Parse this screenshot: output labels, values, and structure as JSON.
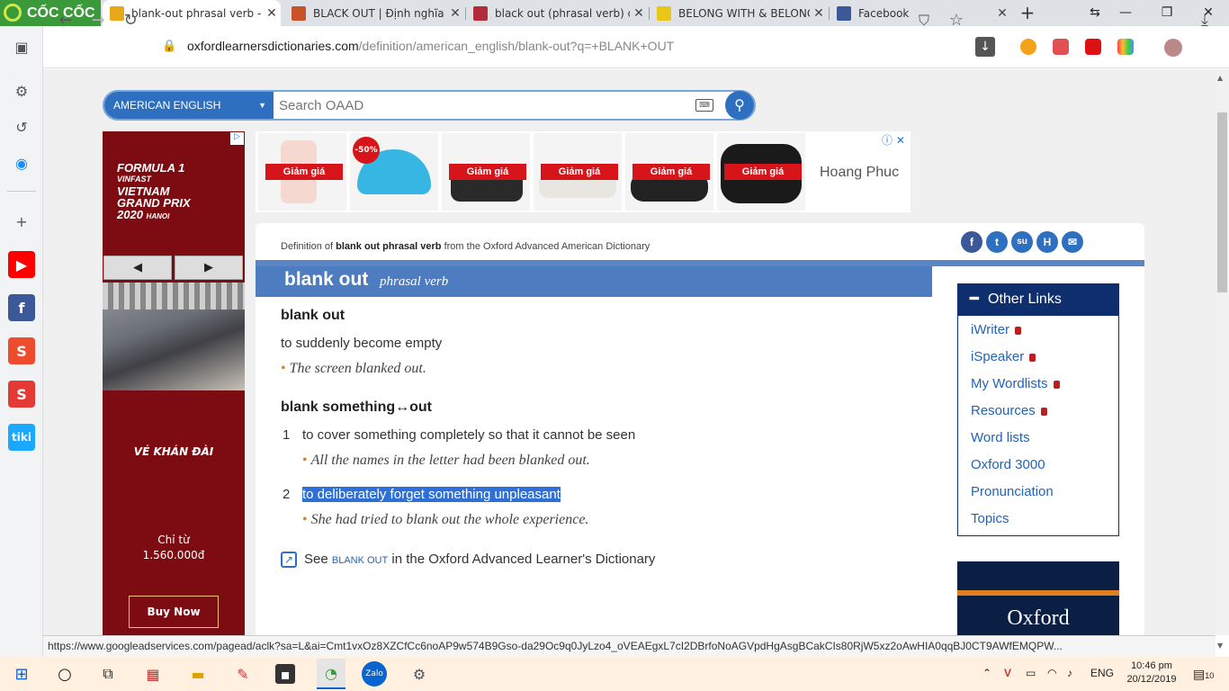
{
  "browser": {
    "brand": "CỐC CỐC"
  },
  "tabs": [
    {
      "title": "blank-out phrasal verb - De",
      "fav_color": "#e7a81b"
    },
    {
      "title": "BLACK OUT | Định nghĩa tro",
      "fav_color": "#c9522b"
    },
    {
      "title": "black out (phrasal verb) def",
      "fav_color": "#b22b3a"
    },
    {
      "title": "BELONG WITH & BELONG T",
      "fav_color": "#e9c71a"
    },
    {
      "title": "Facebook",
      "fav_color": "#3b5998"
    }
  ],
  "address": {
    "domain": "oxfordlearnersdictionaries.com",
    "path": "/definition/american_english/blank-out?q=+BLANK+OUT"
  },
  "search": {
    "dictionary": "AMERICAN ENGLISH",
    "placeholder": "Search OAAD"
  },
  "ads": {
    "left": {
      "nav_prev": "◀",
      "nav_next": "▶",
      "logo_lines": [
        "FORMULA 1",
        "VINFAST",
        "VIETNAM",
        "GRAND PRIX",
        "2020"
      ],
      "logo_city": "HANOI",
      "tagline": "VÉ KHÁN ĐÀI",
      "price_prefix": "Chỉ từ",
      "price": "1.560.000đ",
      "cta": "Buy Now"
    },
    "top": {
      "sale_label": "Giảm giá",
      "discount_badge": "-50%",
      "brand": "Hoang Phuc"
    }
  },
  "entry": {
    "source_prefix": "Definition of ",
    "source_word": "blank out phrasal verb",
    "source_suffix": " from the Oxford Advanced American Dictionary",
    "headword": "blank out",
    "pos": "phrasal verb",
    "sense1_head": "blank out",
    "sense1_def": "to suddenly become empty",
    "sense1_ex": "The screen blanked out.",
    "sense2_head": "blank something↔out",
    "sense2a_num": "1",
    "sense2a_def": "to cover something completely so that it cannot be seen",
    "sense2a_ex": "All the names in the letter had been blanked out.",
    "sense2b_num": "2",
    "sense2b_def": "to deliberately forget something unpleasant",
    "sense2b_ex": "She had tried to blank out the whole experience.",
    "see_prefix": "See",
    "see_link": "BLANK OUT",
    "see_suffix": "in the Oxford Advanced Learner's Dictionary"
  },
  "share": [
    "f",
    "t",
    "su",
    "H",
    "✉"
  ],
  "other_links": {
    "title": "Other Links",
    "items": [
      {
        "label": "iWriter",
        "locked": true
      },
      {
        "label": "iSpeaker",
        "locked": true
      },
      {
        "label": "My Wordlists",
        "locked": true
      },
      {
        "label": "Resources",
        "locked": true
      },
      {
        "label": "Word lists",
        "locked": false
      },
      {
        "label": "Oxford 3000",
        "locked": false
      },
      {
        "label": "Pronunciation",
        "locked": false
      },
      {
        "label": "Topics",
        "locked": false
      }
    ]
  },
  "oxford_ad": {
    "brand": "Oxford"
  },
  "status_url": "https://www.googleadservices.com/pagead/aclk?sa=L&ai=Cmt1vxOz8XZCfCc6noAP9w574B9Gso-da29Oc9q0JyLzo4_oVEAEgxL7cI2DBrfoNoAGVpdHgAsgBCakCIs80RjW5xz2oAwHIA0qqBJ0CT9AWfEMQPW...",
  "taskbar": {
    "lang": "ENG",
    "time": "10:46 pm",
    "date": "20/12/2019",
    "notif_count": "10"
  }
}
